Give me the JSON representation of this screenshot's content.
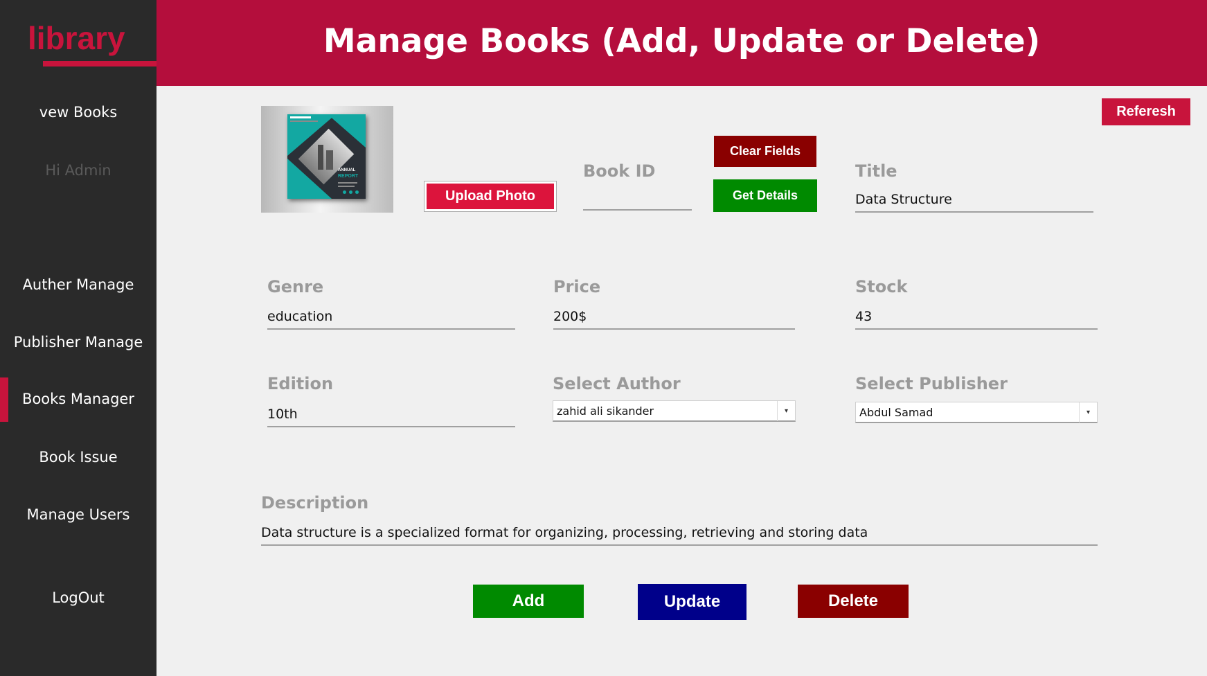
{
  "sidebar": {
    "logo": "library",
    "items": [
      {
        "label": "vew Books"
      },
      {
        "label": "Hi Admin"
      },
      {
        "label": "Auther Manage"
      },
      {
        "label": "Publisher Manage"
      },
      {
        "label": "Books Manager"
      },
      {
        "label": "Book Issue"
      },
      {
        "label": "Manage Users"
      },
      {
        "label": "LogOut"
      }
    ],
    "active_item": "Books Manager",
    "colors": {
      "background": "#2a2a2a",
      "accent": "#c8143c"
    }
  },
  "header": {
    "title": "Manage Books (Add, Update or Delete)",
    "color": "#b40e3c"
  },
  "photo": {
    "cover_title": "ANNUAL",
    "cover_subtitle": "REPORT",
    "icon": "book-cover-image"
  },
  "buttons": {
    "refresh": "Referesh",
    "clear": "Clear Fields",
    "get_details": "Get Details",
    "upload": "Upload Photo",
    "add": "Add",
    "update": "Update",
    "delete": "Delete"
  },
  "form": {
    "book_id": {
      "label": "Book ID",
      "value": ""
    },
    "title": {
      "label": "Title",
      "value": "Data Structure"
    },
    "genre": {
      "label": "Genre",
      "value": "education"
    },
    "price": {
      "label": "Price",
      "value": "200$"
    },
    "stock": {
      "label": "Stock",
      "value": "43"
    },
    "edition": {
      "label": "Edition",
      "value": "10th"
    },
    "author": {
      "label": "Select Author",
      "value": "zahid ali sikander"
    },
    "publisher": {
      "label": "Select Publisher",
      "value": "Abdul Samad"
    },
    "description": {
      "label": "Description",
      "value": "Data structure is a specialized format for organizing, processing, retrieving and storing data"
    }
  },
  "icons": {
    "dropdown_arrow": "▾"
  }
}
